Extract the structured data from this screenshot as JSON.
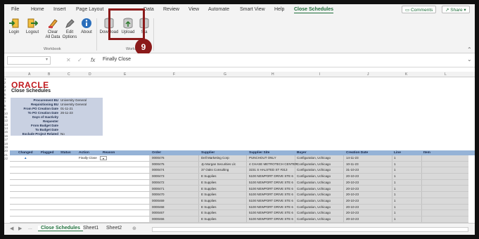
{
  "tabs": [
    "File",
    "Home",
    "Insert",
    "Page Layout",
    "Data",
    "Review",
    "View",
    "Automate",
    "Smart View",
    "Help",
    "Close Schedules"
  ],
  "active_tab": "Close Schedules",
  "buttons": {
    "comments": "Comments",
    "share": "Share"
  },
  "ribbon": {
    "items": [
      {
        "label": "Login",
        "icon": "login-icon"
      },
      {
        "label": "Logout",
        "icon": "logout-icon"
      },
      {
        "label": "Clear",
        "label2": "All Data",
        "icon": "clear-icon"
      },
      {
        "label": "Edit",
        "label2": "Options",
        "icon": "edit-icon"
      },
      {
        "label": "About",
        "icon": "about-icon"
      },
      {
        "label": "Download",
        "icon": "download-icon"
      },
      {
        "label": "Upload",
        "icon": "upload-icon"
      },
      {
        "label": "Sta",
        "icon": "status-icon"
      }
    ],
    "group1": "Workbook",
    "group2": "Workshee",
    "badge": "9"
  },
  "formula": {
    "namebox": "",
    "fx": "fx",
    "value": "Finally Close"
  },
  "oracle_logo": "ORACLE",
  "title": "Close Schedules",
  "params": [
    {
      "label": "Procurement BU",
      "value": "University General"
    },
    {
      "label": "Requisitioning BU",
      "value": "University General"
    },
    {
      "label": "From PO Creation Date",
      "value": "01-11-21"
    },
    {
      "label": "To PO Creation Date",
      "value": "26-11-23"
    },
    {
      "label": "Days of Inactivity",
      "value": ""
    },
    {
      "label": "Requester",
      "value": ""
    },
    {
      "label": "From Budget Date",
      "value": ""
    },
    {
      "label": "To Budget Date",
      "value": ""
    },
    {
      "label": "Exclude Project Related",
      "value": "No"
    }
  ],
  "columns": [
    "Changed",
    "Flagged",
    "Status",
    "Action",
    "Reason",
    "Order",
    "Supplier",
    "Supplier Site",
    "Buyer",
    "Creation Date",
    "Line",
    "Item"
  ],
  "col_letters": [
    "A",
    "B",
    "C",
    "D",
    "E",
    "F",
    "G",
    "H",
    "I",
    "J",
    "K",
    "L"
  ],
  "rows": [
    {
      "changed": "▲",
      "action": "Finally Close",
      "order": "0000476",
      "supplier": "Dell Marketing Corp",
      "site": "PUNCHOUT ONLY",
      "buyer": "Configuration, Uchicago",
      "date": "14-11-23",
      "line": "1"
    },
    {
      "changed": "",
      "action": "",
      "order": "0000475",
      "supplier": "Jp Morgan Securities Llc",
      "site": "4 CHASE METROTECH CENTER",
      "buyer": "Configuration, Uchicago",
      "date": "10-11-23",
      "line": "1"
    },
    {
      "changed": "",
      "action": "",
      "order": "0000474",
      "supplier": "37 Oaks Consulting",
      "site": "3231 S HALSTED ST #313",
      "buyer": "Configuration, Uchicago",
      "date": "31-10-23",
      "line": "1"
    },
    {
      "changed": "",
      "action": "",
      "order": "0000473",
      "supplier": "E Supplies",
      "site": "5100 NEWPORT DRIVE STE 6",
      "buyer": "Configuration, Uchicago",
      "date": "20-10-23",
      "line": "1"
    },
    {
      "changed": "",
      "action": "",
      "order": "0000472",
      "supplier": "E Supplies",
      "site": "5100 NEWPORT DRIVE STE 6",
      "buyer": "Configuration, Uchicago",
      "date": "20-10-23",
      "line": "1"
    },
    {
      "changed": "",
      "action": "",
      "order": "0000471",
      "supplier": "E Supplies",
      "site": "5100 NEWPORT DRIVE STE 6",
      "buyer": "Configuration, Uchicago",
      "date": "20-10-23",
      "line": "1"
    },
    {
      "changed": "",
      "action": "",
      "order": "0000470",
      "supplier": "E Supplies",
      "site": "5100 NEWPORT DRIVE STE 6",
      "buyer": "Configuration, Uchicago",
      "date": "20-10-23",
      "line": "1"
    },
    {
      "changed": "",
      "action": "",
      "order": "0000469",
      "supplier": "E Supplies",
      "site": "5100 NEWPORT DRIVE STE 6",
      "buyer": "Configuration, Uchicago",
      "date": "20-10-23",
      "line": "1"
    },
    {
      "changed": "",
      "action": "",
      "order": "0000468",
      "supplier": "E Supplies",
      "site": "5100 NEWPORT DRIVE STE 6",
      "buyer": "Configuration, Uchicago",
      "date": "20-10-23",
      "line": "1"
    },
    {
      "changed": "",
      "action": "",
      "order": "0000467",
      "supplier": "E Supplies",
      "site": "5100 NEWPORT DRIVE STE 6",
      "buyer": "Configuration, Uchicago",
      "date": "20-10-23",
      "line": "1"
    },
    {
      "changed": "",
      "action": "",
      "order": "0000466",
      "supplier": "E Supplies",
      "site": "5100 NEWPORT DRIVE STE 6",
      "buyer": "Configuration, Uchicago",
      "date": "20-10-23",
      "line": "1"
    }
  ],
  "sheets": [
    "Close Schedules",
    "Sheet1",
    "Sheet2"
  ],
  "colors": {
    "accent": "#1e6e3a",
    "highlight": "#8b1a1a",
    "header": "#95b3d7",
    "param": "#c9d1e2"
  }
}
